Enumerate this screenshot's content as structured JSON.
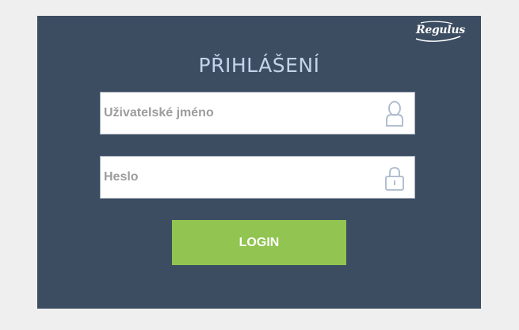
{
  "logo": {
    "text": "Regulus"
  },
  "login": {
    "title": "PŘIHLÁŠENÍ",
    "username": {
      "placeholder": "Uživatelské jméno",
      "value": "",
      "icon": "user-icon"
    },
    "password": {
      "placeholder": "Heslo",
      "value": "",
      "icon": "lock-icon"
    },
    "submit_label": "LOGIN"
  },
  "colors": {
    "background": "#efefef",
    "panel": "#3c4d62",
    "title": "#c5d3e8",
    "button": "#91c450",
    "button_text": "#ffffff",
    "icon": "#aab8cc"
  }
}
